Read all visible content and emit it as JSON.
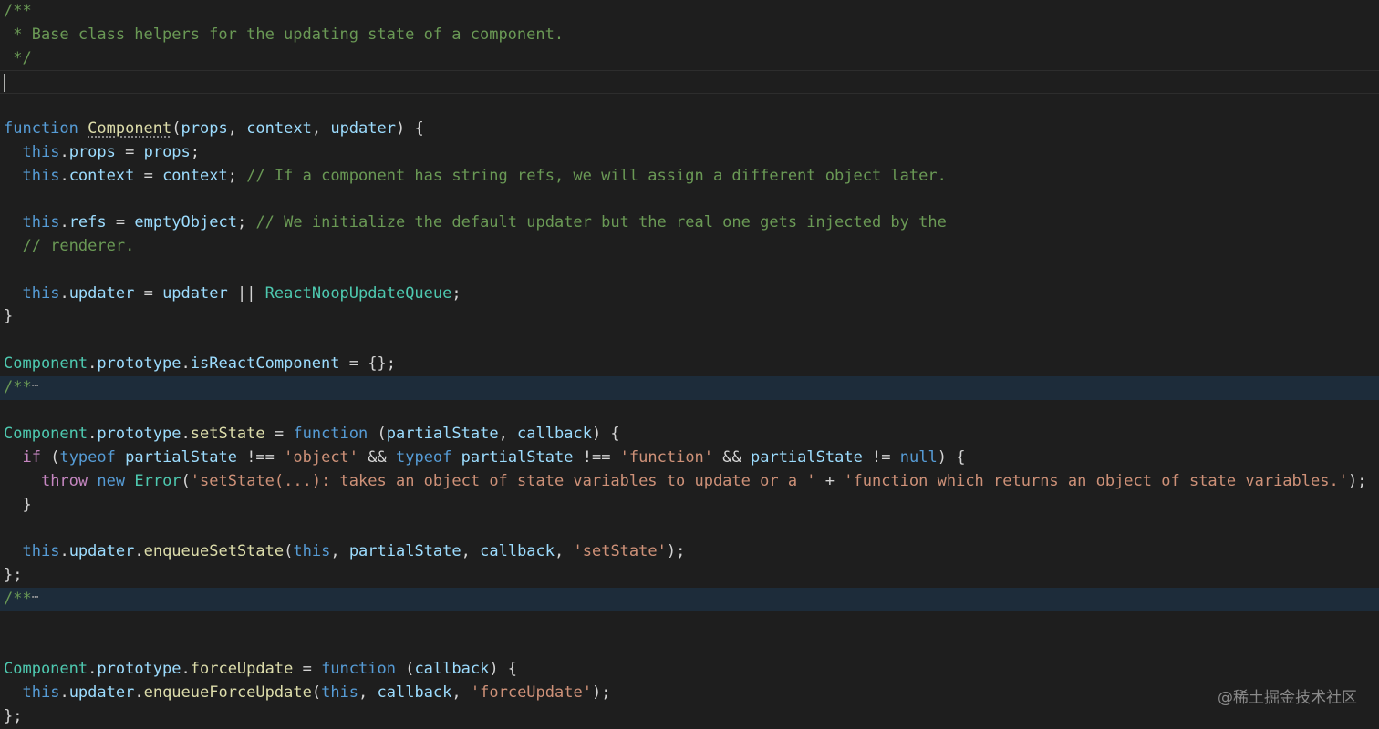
{
  "editor": {
    "theme": {
      "background": "#1e1e1e",
      "folded_background": "#1d2c3a",
      "comment": "#6a9955",
      "keyword": "#569cd6",
      "control": "#c586c0",
      "function": "#dcdcaa",
      "class": "#4ec9b0",
      "variable": "#9cdcfe",
      "string": "#ce9178",
      "punctuation": "#d4d4d4"
    },
    "lines": [
      {
        "tokens": [
          {
            "t": "comment",
            "v": "/**"
          }
        ]
      },
      {
        "tokens": [
          {
            "t": "comment",
            "v": " * Base class helpers for the updating state of a component."
          }
        ]
      },
      {
        "tokens": [
          {
            "t": "comment",
            "v": " */"
          }
        ]
      },
      {
        "current": true,
        "tokens": []
      },
      {
        "tokens": []
      },
      {
        "tokens": [
          {
            "t": "keyword",
            "v": "function"
          },
          {
            "t": "punct",
            "v": " "
          },
          {
            "t": "function",
            "v": "Component",
            "squiggle": true
          },
          {
            "t": "punct",
            "v": "("
          },
          {
            "t": "var",
            "v": "props"
          },
          {
            "t": "punct",
            "v": ", "
          },
          {
            "t": "var",
            "v": "context"
          },
          {
            "t": "punct",
            "v": ", "
          },
          {
            "t": "var",
            "v": "updater"
          },
          {
            "t": "punct",
            "v": ") {"
          }
        ]
      },
      {
        "tokens": [
          {
            "t": "punct",
            "v": "  "
          },
          {
            "t": "keyword",
            "v": "this"
          },
          {
            "t": "punct",
            "v": "."
          },
          {
            "t": "var",
            "v": "props"
          },
          {
            "t": "punct",
            "v": " = "
          },
          {
            "t": "var",
            "v": "props"
          },
          {
            "t": "punct",
            "v": ";"
          }
        ]
      },
      {
        "tokens": [
          {
            "t": "punct",
            "v": "  "
          },
          {
            "t": "keyword",
            "v": "this"
          },
          {
            "t": "punct",
            "v": "."
          },
          {
            "t": "var",
            "v": "context"
          },
          {
            "t": "punct",
            "v": " = "
          },
          {
            "t": "var",
            "v": "context"
          },
          {
            "t": "punct",
            "v": "; "
          },
          {
            "t": "comment",
            "v": "// If a component has string refs, we will assign a different object later."
          }
        ]
      },
      {
        "tokens": []
      },
      {
        "tokens": [
          {
            "t": "punct",
            "v": "  "
          },
          {
            "t": "keyword",
            "v": "this"
          },
          {
            "t": "punct",
            "v": "."
          },
          {
            "t": "var",
            "v": "refs"
          },
          {
            "t": "punct",
            "v": " = "
          },
          {
            "t": "var",
            "v": "emptyObject"
          },
          {
            "t": "punct",
            "v": "; "
          },
          {
            "t": "comment",
            "v": "// We initialize the default updater but the real one gets injected by the"
          }
        ]
      },
      {
        "tokens": [
          {
            "t": "punct",
            "v": "  "
          },
          {
            "t": "comment",
            "v": "// renderer."
          }
        ]
      },
      {
        "tokens": []
      },
      {
        "tokens": [
          {
            "t": "punct",
            "v": "  "
          },
          {
            "t": "keyword",
            "v": "this"
          },
          {
            "t": "punct",
            "v": "."
          },
          {
            "t": "var",
            "v": "updater"
          },
          {
            "t": "punct",
            "v": " = "
          },
          {
            "t": "var",
            "v": "updater"
          },
          {
            "t": "punct",
            "v": " || "
          },
          {
            "t": "class",
            "v": "ReactNoopUpdateQueue"
          },
          {
            "t": "punct",
            "v": ";"
          }
        ]
      },
      {
        "tokens": [
          {
            "t": "punct",
            "v": "}"
          }
        ]
      },
      {
        "tokens": []
      },
      {
        "tokens": [
          {
            "t": "class",
            "v": "Component"
          },
          {
            "t": "punct",
            "v": "."
          },
          {
            "t": "var",
            "v": "prototype"
          },
          {
            "t": "punct",
            "v": "."
          },
          {
            "t": "var",
            "v": "isReactComponent"
          },
          {
            "t": "punct",
            "v": " = {};"
          }
        ]
      },
      {
        "folded": true,
        "ellipsis": "⋯",
        "tokens": [
          {
            "t": "comment",
            "v": "/**"
          }
        ]
      },
      {
        "tokens": []
      },
      {
        "tokens": [
          {
            "t": "class",
            "v": "Component"
          },
          {
            "t": "punct",
            "v": "."
          },
          {
            "t": "var",
            "v": "prototype"
          },
          {
            "t": "punct",
            "v": "."
          },
          {
            "t": "function",
            "v": "setState"
          },
          {
            "t": "punct",
            "v": " = "
          },
          {
            "t": "keyword",
            "v": "function"
          },
          {
            "t": "punct",
            "v": " ("
          },
          {
            "t": "var",
            "v": "partialState"
          },
          {
            "t": "punct",
            "v": ", "
          },
          {
            "t": "var",
            "v": "callback"
          },
          {
            "t": "punct",
            "v": ") {"
          }
        ]
      },
      {
        "tokens": [
          {
            "t": "punct",
            "v": "  "
          },
          {
            "t": "control",
            "v": "if"
          },
          {
            "t": "punct",
            "v": " ("
          },
          {
            "t": "keyword",
            "v": "typeof"
          },
          {
            "t": "punct",
            "v": " "
          },
          {
            "t": "var",
            "v": "partialState"
          },
          {
            "t": "punct",
            "v": " !== "
          },
          {
            "t": "string",
            "v": "'object'"
          },
          {
            "t": "punct",
            "v": " && "
          },
          {
            "t": "keyword",
            "v": "typeof"
          },
          {
            "t": "punct",
            "v": " "
          },
          {
            "t": "var",
            "v": "partialState"
          },
          {
            "t": "punct",
            "v": " !== "
          },
          {
            "t": "string",
            "v": "'function'"
          },
          {
            "t": "punct",
            "v": " && "
          },
          {
            "t": "var",
            "v": "partialState"
          },
          {
            "t": "punct",
            "v": " != "
          },
          {
            "t": "keyword",
            "v": "null"
          },
          {
            "t": "punct",
            "v": ") {"
          }
        ]
      },
      {
        "tokens": [
          {
            "t": "punct",
            "v": "    "
          },
          {
            "t": "control",
            "v": "throw"
          },
          {
            "t": "punct",
            "v": " "
          },
          {
            "t": "keyword",
            "v": "new"
          },
          {
            "t": "punct",
            "v": " "
          },
          {
            "t": "class",
            "v": "Error"
          },
          {
            "t": "punct",
            "v": "("
          },
          {
            "t": "string",
            "v": "'setState(...): takes an object of state variables to update or a '"
          },
          {
            "t": "punct",
            "v": " + "
          },
          {
            "t": "string",
            "v": "'function which returns an object of state variables.'"
          },
          {
            "t": "punct",
            "v": ");"
          }
        ]
      },
      {
        "tokens": [
          {
            "t": "punct",
            "v": "  }"
          }
        ]
      },
      {
        "tokens": []
      },
      {
        "tokens": [
          {
            "t": "punct",
            "v": "  "
          },
          {
            "t": "keyword",
            "v": "this"
          },
          {
            "t": "punct",
            "v": "."
          },
          {
            "t": "var",
            "v": "updater"
          },
          {
            "t": "punct",
            "v": "."
          },
          {
            "t": "function",
            "v": "enqueueSetState"
          },
          {
            "t": "punct",
            "v": "("
          },
          {
            "t": "keyword",
            "v": "this"
          },
          {
            "t": "punct",
            "v": ", "
          },
          {
            "t": "var",
            "v": "partialState"
          },
          {
            "t": "punct",
            "v": ", "
          },
          {
            "t": "var",
            "v": "callback"
          },
          {
            "t": "punct",
            "v": ", "
          },
          {
            "t": "string",
            "v": "'setState'"
          },
          {
            "t": "punct",
            "v": ");"
          }
        ]
      },
      {
        "tokens": [
          {
            "t": "punct",
            "v": "};"
          }
        ]
      },
      {
        "folded": true,
        "ellipsis": "⋯",
        "tokens": [
          {
            "t": "comment",
            "v": "/**"
          }
        ]
      },
      {
        "tokens": []
      },
      {
        "tokens": []
      },
      {
        "tokens": [
          {
            "t": "class",
            "v": "Component"
          },
          {
            "t": "punct",
            "v": "."
          },
          {
            "t": "var",
            "v": "prototype"
          },
          {
            "t": "punct",
            "v": "."
          },
          {
            "t": "function",
            "v": "forceUpdate"
          },
          {
            "t": "punct",
            "v": " = "
          },
          {
            "t": "keyword",
            "v": "function"
          },
          {
            "t": "punct",
            "v": " ("
          },
          {
            "t": "var",
            "v": "callback"
          },
          {
            "t": "punct",
            "v": ") {"
          }
        ]
      },
      {
        "tokens": [
          {
            "t": "punct",
            "v": "  "
          },
          {
            "t": "keyword",
            "v": "this"
          },
          {
            "t": "punct",
            "v": "."
          },
          {
            "t": "var",
            "v": "updater"
          },
          {
            "t": "punct",
            "v": "."
          },
          {
            "t": "function",
            "v": "enqueueForceUpdate"
          },
          {
            "t": "punct",
            "v": "("
          },
          {
            "t": "keyword",
            "v": "this"
          },
          {
            "t": "punct",
            "v": ", "
          },
          {
            "t": "var",
            "v": "callback"
          },
          {
            "t": "punct",
            "v": ", "
          },
          {
            "t": "string",
            "v": "'forceUpdate'"
          },
          {
            "t": "punct",
            "v": ");"
          }
        ]
      },
      {
        "tokens": [
          {
            "t": "punct",
            "v": "};"
          }
        ]
      }
    ]
  },
  "watermark": {
    "text": "@稀土掘金技术社区"
  }
}
